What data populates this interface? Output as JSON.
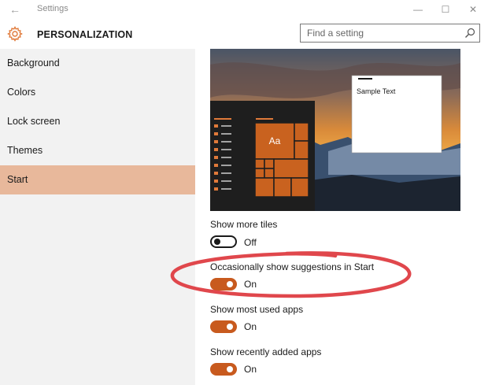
{
  "window": {
    "title": "Settings",
    "back_glyph": "←",
    "minimize_glyph": "—",
    "maximize_glyph": "☐",
    "close_glyph": "✕"
  },
  "header": {
    "section_title": "PERSONALIZATION",
    "icon": "gear-icon",
    "accent_color": "#e07a3a"
  },
  "search": {
    "placeholder": "Find a setting",
    "value": ""
  },
  "sidebar": {
    "items": [
      {
        "label": "Background",
        "selected": false
      },
      {
        "label": "Colors",
        "selected": false
      },
      {
        "label": "Lock screen",
        "selected": false
      },
      {
        "label": "Themes",
        "selected": false
      },
      {
        "label": "Start",
        "selected": true
      }
    ],
    "selected_color": "#e8b89b"
  },
  "preview": {
    "sample_text": "Sample Text",
    "tile_label": "Aa",
    "tile_color": "#c9621f"
  },
  "settings": [
    {
      "label": "Show more tiles",
      "state": "Off",
      "on": false
    },
    {
      "label": "Occasionally show suggestions in Start",
      "state": "On",
      "on": true
    },
    {
      "label": "Show most used apps",
      "state": "On",
      "on": true
    },
    {
      "label": "Show recently added apps",
      "state": "On",
      "on": true
    }
  ],
  "toggle_on_color": "#c85a1e",
  "annotation_color": "#e0474c"
}
